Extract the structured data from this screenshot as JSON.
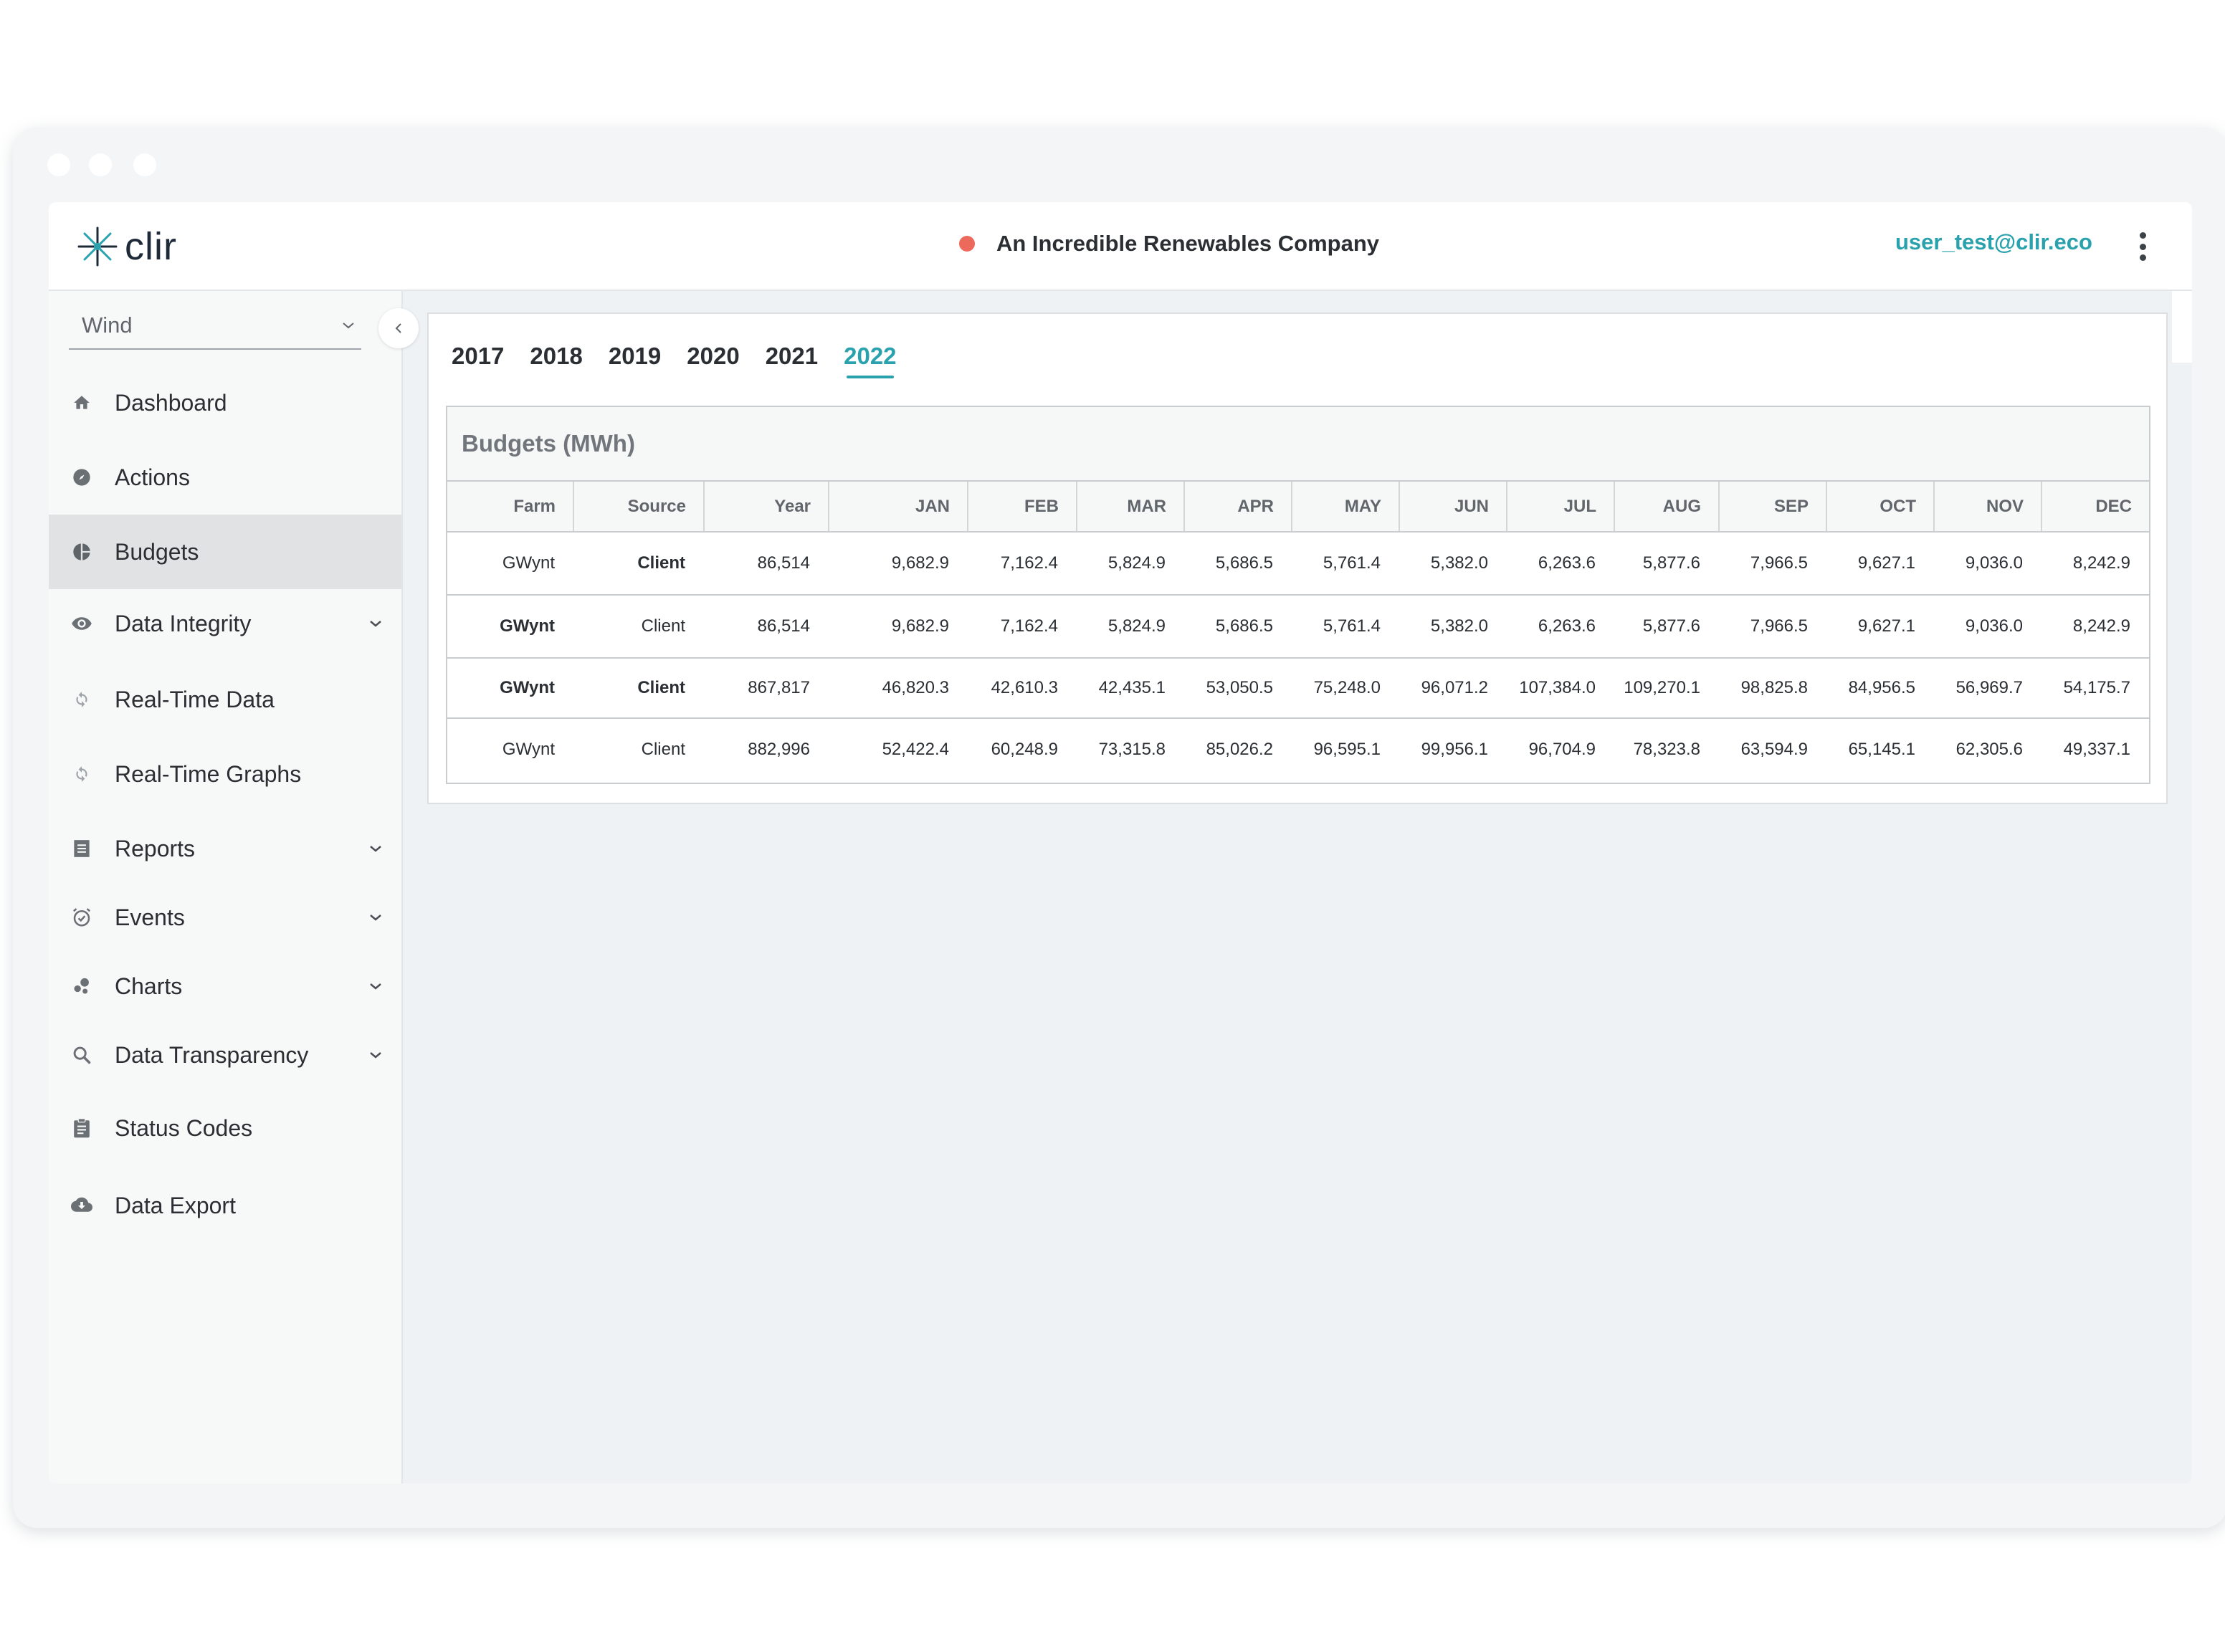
{
  "header": {
    "logo_text": "clir",
    "company_name": "An Incredible Renewables Company",
    "status_color": "#ec6a5c",
    "user_email": "user_test@clir.eco",
    "menu_icon": "more-vertical-icon"
  },
  "sidebar": {
    "selector_value": "Wind",
    "items": [
      {
        "label": "Dashboard",
        "icon": "home-icon"
      },
      {
        "label": "Actions",
        "icon": "compass-icon"
      },
      {
        "label": "Budgets",
        "icon": "pie-chart-icon"
      },
      {
        "label": "Data Integrity",
        "icon": "eye-icon"
      },
      {
        "label": "Real-Time Data",
        "icon": "refresh-icon"
      },
      {
        "label": "Real-Time Graphs",
        "icon": "refresh-icon"
      },
      {
        "label": "Reports",
        "icon": "list-icon"
      },
      {
        "label": "Events",
        "icon": "alarm-clock-icon"
      },
      {
        "label": "Charts",
        "icon": "bubble-chart-icon"
      },
      {
        "label": "Data Transparency",
        "icon": "search-icon"
      },
      {
        "label": "Status Codes",
        "icon": "clipboard-icon"
      },
      {
        "label": "Data Export",
        "icon": "cloud-download-icon"
      }
    ],
    "active_item": "Budgets"
  },
  "main": {
    "year_tabs": [
      "2017",
      "2018",
      "2019",
      "2020",
      "2021",
      "2022"
    ],
    "active_year": "2022",
    "card_title": "Budgets (MWh)",
    "table": {
      "headers": [
        "Farm",
        "Source",
        "Year",
        "JAN",
        "FEB",
        "MAR",
        "APR",
        "MAY",
        "JUN",
        "JUL",
        "AUG",
        "SEP",
        "OCT",
        "NOV",
        "DEC"
      ],
      "rows": [
        [
          "GWynt",
          "Client",
          "86,514",
          "9,682.9",
          "7,162.4",
          "5,824.9",
          "5,686.5",
          "5,761.4",
          "5,382.0",
          "6,263.6",
          "5,877.6",
          "7,966.5",
          "9,627.1",
          "9,036.0",
          "8,242.9"
        ],
        [
          "GWynt",
          "Client",
          "86,514",
          "9,682.9",
          "7,162.4",
          "5,824.9",
          "5,686.5",
          "5,761.4",
          "5,382.0",
          "6,263.6",
          "5,877.6",
          "7,966.5",
          "9,627.1",
          "9,036.0",
          "8,242.9"
        ],
        [
          "GWynt",
          "Client",
          "867,817",
          "46,820.3",
          "42,610.3",
          "42,435.1",
          "53,050.5",
          "75,248.0",
          "96,071.2",
          "107,384.0",
          "109,270.1",
          "98,825.8",
          "84,956.5",
          "56,969.7",
          "54,175.7"
        ],
        [
          "GWynt",
          "Client",
          "882,996",
          "52,422.4",
          "60,248.9",
          "73,315.8",
          "85,026.2",
          "96,595.1",
          "99,956.1",
          "96,704.9",
          "78,323.8",
          "63,594.9",
          "65,145.1",
          "62,305.6",
          "49,337.1"
        ]
      ]
    }
  },
  "colors": {
    "accent": "#2aa2ad",
    "status_dot": "#ec6a5c",
    "active_nav_bg": "#e1e2e3"
  }
}
